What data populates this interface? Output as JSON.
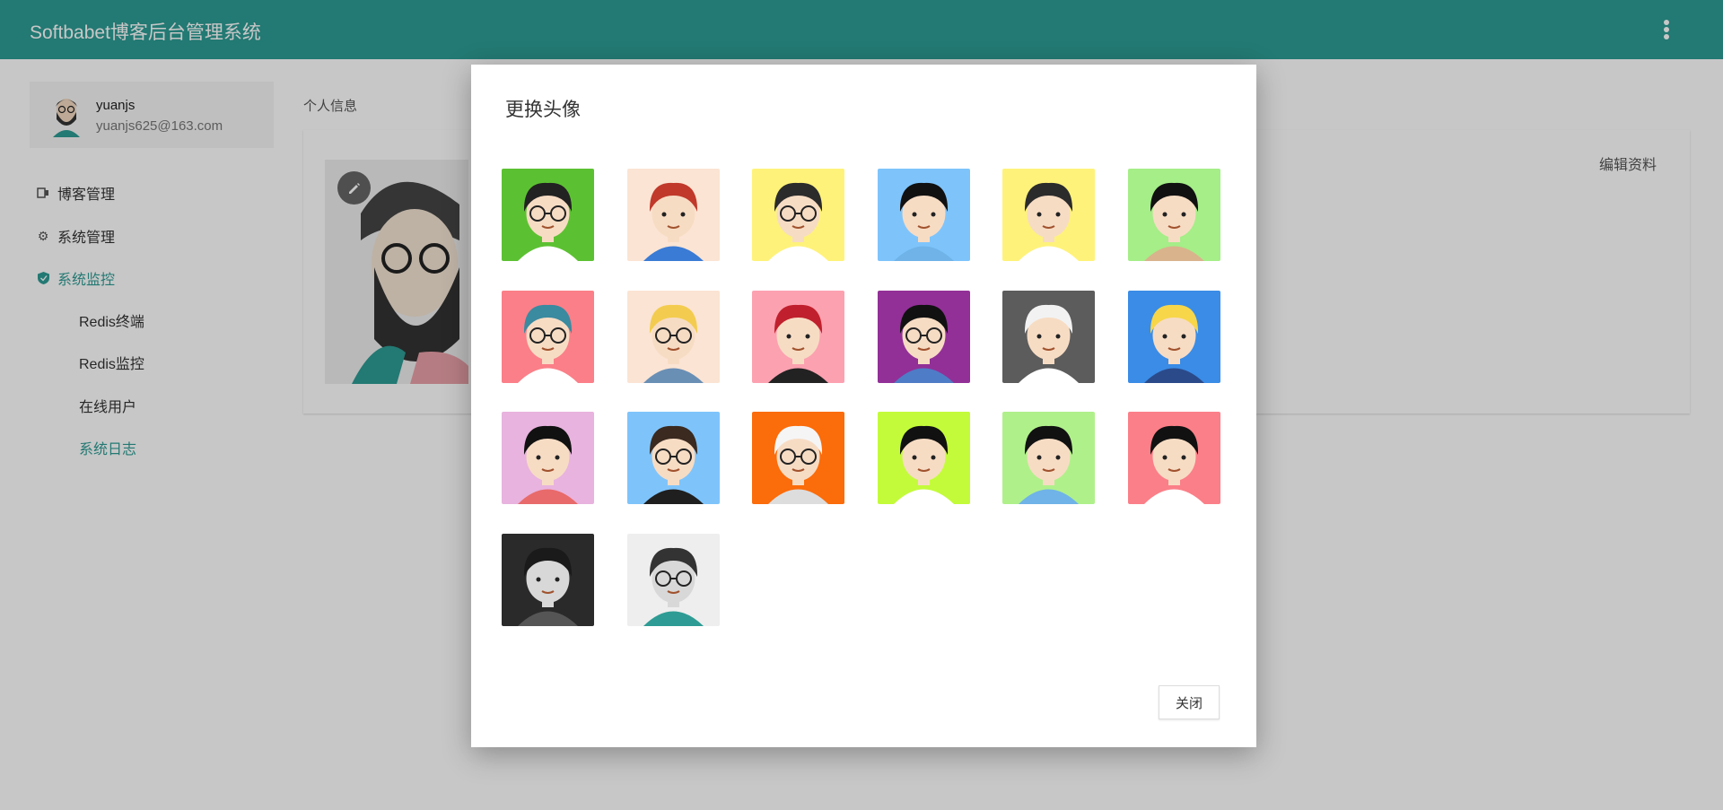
{
  "app": {
    "title": "Softbabet博客后台管理系统"
  },
  "user": {
    "name": "yuanjs",
    "email": "yuanjs625@163.com"
  },
  "sidebar": {
    "items": [
      {
        "label": "博客管理",
        "icon": "blog-manage-icon"
      },
      {
        "label": "系统管理",
        "icon": "gear-icon"
      },
      {
        "label": "系统监控",
        "icon": "shield-icon"
      }
    ],
    "subitems": [
      {
        "label": "Redis终端"
      },
      {
        "label": "Redis监控"
      },
      {
        "label": "在线用户"
      },
      {
        "label": "系统日志"
      }
    ]
  },
  "main": {
    "breadcrumb": "个人信息",
    "edit_profile": "编辑资料"
  },
  "modal": {
    "title": "更换头像",
    "close_label": "关闭",
    "avatars": [
      {
        "bg": "#5cc132",
        "hair": "#222222",
        "glasses": true,
        "cloth": "#ffffff"
      },
      {
        "bg": "#fbe4d3",
        "hair": "#c0392b",
        "glasses": false,
        "cloth": "#3a7bd5"
      },
      {
        "bg": "#fff27a",
        "hair": "#2b2b2b",
        "glasses": true,
        "cloth": "#ffffff"
      },
      {
        "bg": "#7ec4fb",
        "hair": "#111111",
        "glasses": false,
        "cloth": "#6fb3e8"
      },
      {
        "bg": "#fff27a",
        "hair": "#2b2b2b",
        "glasses": false,
        "cloth": "#ffffff"
      },
      {
        "bg": "#a5ee88",
        "hair": "#111111",
        "glasses": false,
        "cloth": "#d9b38c"
      },
      {
        "bg": "#fb7f88",
        "hair": "#3a8aa0",
        "glasses": true,
        "cloth": "#ffffff"
      },
      {
        "bg": "#fbe4d3",
        "hair": "#f3cc4f",
        "glasses": true,
        "cloth": "#6a8fb5"
      },
      {
        "bg": "#fca1b0",
        "hair": "#c0202d",
        "glasses": false,
        "cloth": "#222222"
      },
      {
        "bg": "#923097",
        "hair": "#111111",
        "glasses": true,
        "cloth": "#4f7cc6"
      },
      {
        "bg": "#5c5c5c",
        "hair": "#f2f2f2",
        "glasses": false,
        "cloth": "#ffffff"
      },
      {
        "bg": "#3a8ce6",
        "hair": "#f7d64a",
        "glasses": false,
        "cloth": "#2b4a8a"
      },
      {
        "bg": "#e8b3de",
        "hair": "#111111",
        "glasses": false,
        "cloth": "#e86a6a"
      },
      {
        "bg": "#7ec4fb",
        "hair": "#3a2a20",
        "glasses": true,
        "cloth": "#1f1f1f"
      },
      {
        "bg": "#fb6c0a",
        "hair": "#f5f5f5",
        "glasses": true,
        "cloth": "#dddddd"
      },
      {
        "bg": "#c3fb3a",
        "hair": "#111111",
        "glasses": false,
        "cloth": "#ffffff"
      },
      {
        "bg": "#b0f08b",
        "hair": "#111111",
        "glasses": false,
        "cloth": "#6fb3e8"
      },
      {
        "bg": "#fb7f88",
        "hair": "#111111",
        "glasses": false,
        "cloth": "#ffffff"
      },
      {
        "bg": "#2a2a2a",
        "hair": "#1a1a1a",
        "glasses": false,
        "cloth": "#555555",
        "photo": true
      },
      {
        "bg": "#eeeeee",
        "hair": "#333333",
        "glasses": true,
        "cloth": "#2e9c94",
        "photo": true
      }
    ]
  }
}
